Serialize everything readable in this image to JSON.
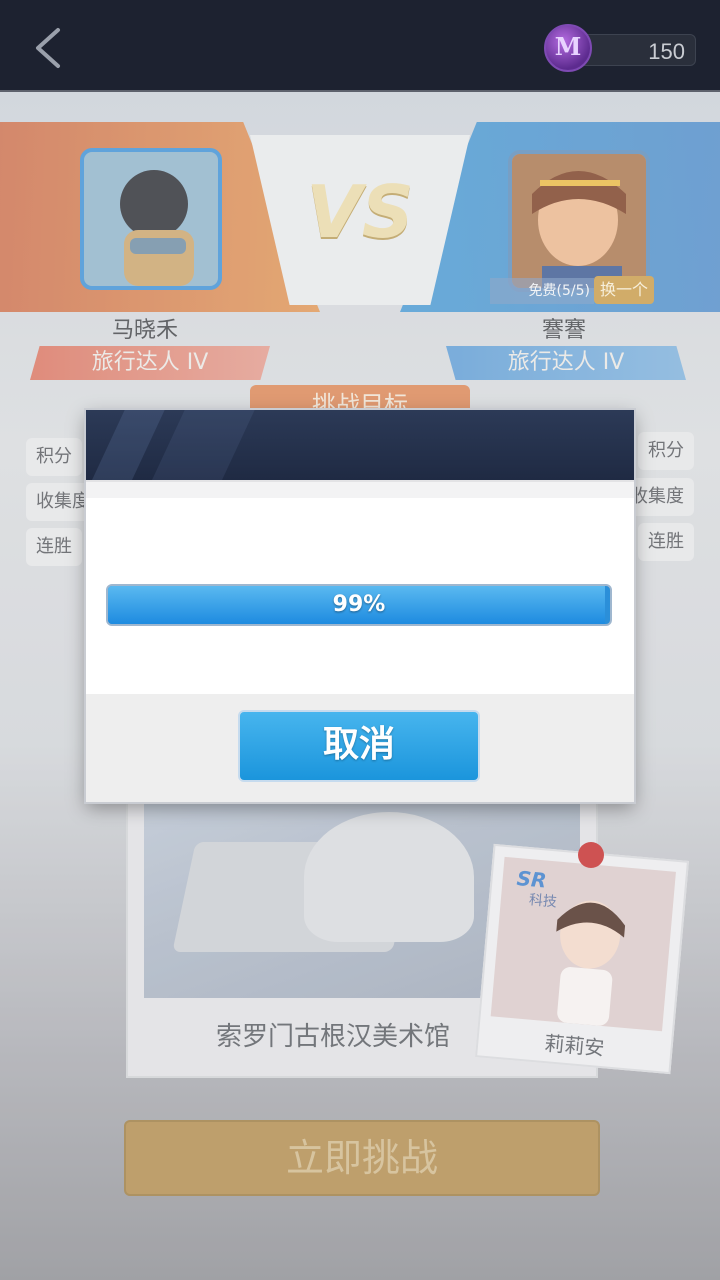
{
  "topbar": {
    "back_icon": "chevron-left-icon",
    "coin": {
      "icon": "m-coin-icon",
      "glyph": "M",
      "value": "150"
    }
  },
  "versus": {
    "vs_label": "VS",
    "left_player": {
      "name": "马晓禾",
      "rank": "旅行达人 IV"
    },
    "right_player": {
      "name": "謇謇",
      "rank": "旅行达人 IV",
      "free_label": "免费(5/5)",
      "swap_label": "换一个"
    },
    "goal_title": "挑战目标"
  },
  "stats": {
    "left": [
      "积分",
      "收集度",
      "连胜"
    ],
    "right": [
      "积分",
      "收集度",
      "连胜"
    ]
  },
  "card": {
    "name": "索罗门古根汉美术馆"
  },
  "photo": {
    "badge": "SR",
    "category": "科技",
    "name": "莉莉安"
  },
  "challenge_button": "立即挑战",
  "modal": {
    "progress": {
      "percent": 99,
      "label": "99%"
    },
    "cancel_label": "取消"
  },
  "colors": {
    "topbar": "#1d2230",
    "progress_fill": "#1e8be0",
    "cancel_button": "#1b95dc",
    "challenge_button": "#b08a4c"
  }
}
